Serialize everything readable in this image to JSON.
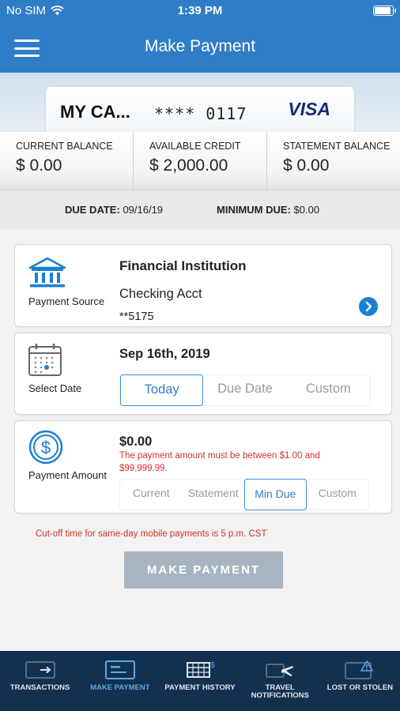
{
  "status_bar": {
    "carrier": "No SIM",
    "time": "1:39 PM"
  },
  "nav": {
    "title": "Make Payment"
  },
  "card": {
    "name": "MY CA...",
    "masked_number": "**** 0117",
    "brand": "VISA"
  },
  "balances": [
    {
      "label": "CURRENT BALANCE",
      "value": "$ 0.00"
    },
    {
      "label": "AVAILABLE CREDIT",
      "value": "$ 2,000.00"
    },
    {
      "label": "STATEMENT BALANCE",
      "value": "$ 0.00"
    }
  ],
  "due": {
    "due_label": "DUE DATE:",
    "due_value": "09/16/19",
    "min_label": "MINIMUM DUE:",
    "min_value": "$0.00"
  },
  "payment_source": {
    "icon_label": "Payment Source",
    "title": "Financial Institution",
    "account_name": "Checking Acct",
    "account_number": "**5175"
  },
  "select_date": {
    "icon_label": "Select Date",
    "date": "Sep 16th, 2019",
    "options": [
      "Today",
      "Due Date",
      "Custom"
    ],
    "selected": "Today"
  },
  "payment_amount": {
    "icon_label": "Payment Amount",
    "amount": "$0.00",
    "error": "The payment amount must be between $1.00 and $99,999.99.",
    "options": [
      "Current",
      "Statement",
      "Min Due",
      "Custom"
    ],
    "selected": "Min Due"
  },
  "cutoff_note": "Cut-off time for same-day mobile payments is 5 p.m. CST",
  "make_payment_button": "MAKE PAYMENT",
  "tabs": [
    {
      "label": "TRANSACTIONS",
      "icon": "transactions-icon"
    },
    {
      "label": "MAKE PAYMENT",
      "icon": "card-payment-icon",
      "active": true
    },
    {
      "label": "PAYMENT HISTORY",
      "icon": "payment-history-icon"
    },
    {
      "label": "TRAVEL NOTIFICATIONS",
      "icon": "travel-icon"
    },
    {
      "label": "LOST OR STOLEN",
      "icon": "lost-card-icon"
    }
  ],
  "colors": {
    "primary": "#2f7dc6",
    "tab_bar": "#13304f",
    "error": "#d0342c",
    "button_disabled": "#a8b5c1"
  }
}
